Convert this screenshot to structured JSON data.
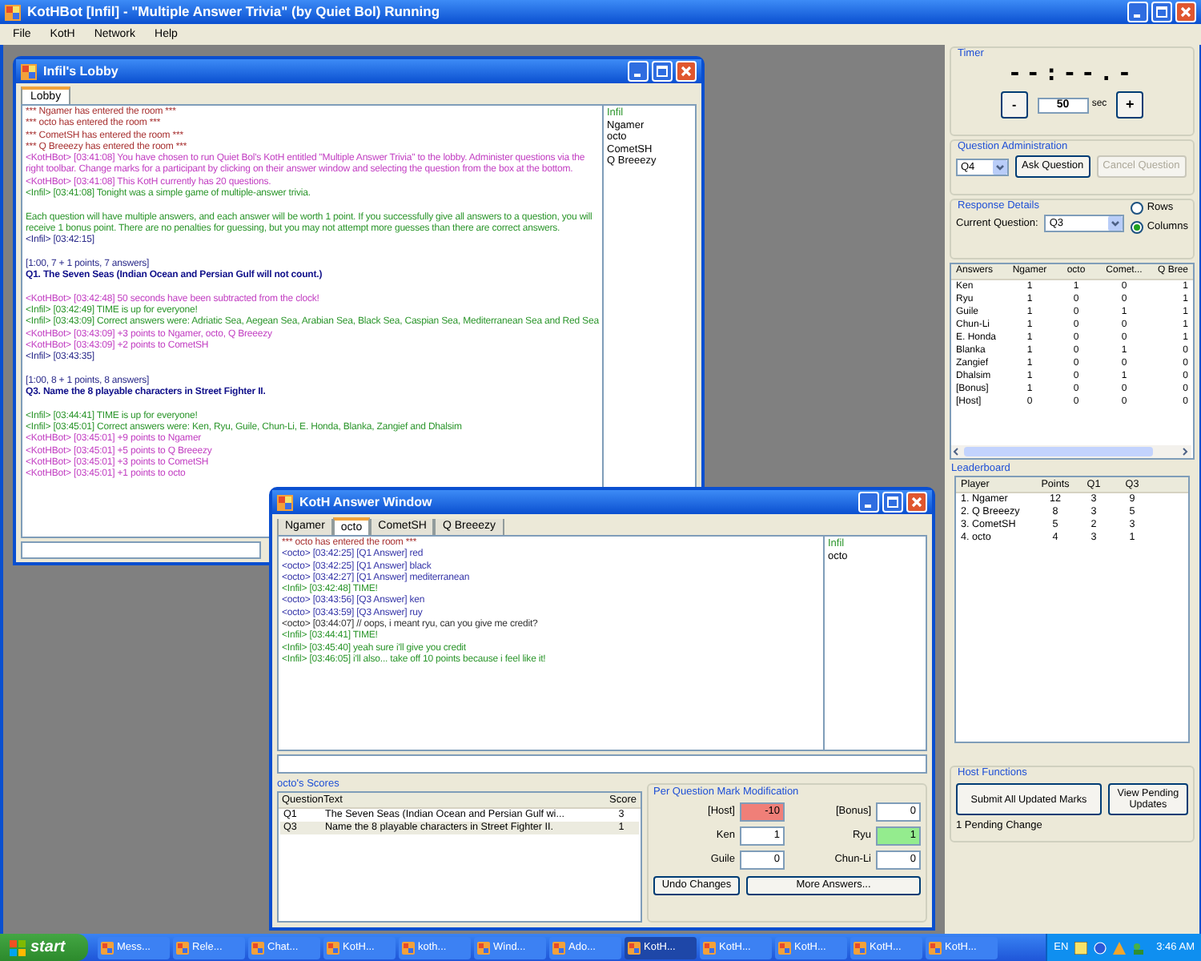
{
  "main_window": {
    "title": "KotHBot [Infil] - \"Multiple Answer Trivia\" (by Quiet Bol) Running",
    "menu": [
      "File",
      "KotH",
      "Network",
      "Help"
    ]
  },
  "lobby_window": {
    "title": "Infil's Lobby",
    "tabs": [
      {
        "label": "Lobby",
        "selected": true
      }
    ],
    "messages": [
      {
        "kind": "system",
        "text": "*** Ngamer has entered the room ***"
      },
      {
        "kind": "system",
        "text": "*** octo has entered the room ***"
      },
      {
        "kind": "system",
        "text": "*** CometSH has entered the room ***"
      },
      {
        "kind": "system",
        "text": "*** Q Breeezy has entered the room ***"
      },
      {
        "kind": "bot",
        "text": "<KotHBot> [03:41:08] You have chosen to run Quiet Bol's KotH entitled \"Multiple Answer Trivia\" to the lobby. Administer questions via the right toolbar. Change marks for a participant by clicking on their answer window and selecting the question from the box at the bottom."
      },
      {
        "kind": "bot",
        "text": "<KotHBot> [03:41:08] This KotH currently has 20 questions."
      },
      {
        "kind": "host",
        "text": "<Infil> [03:41:08] Tonight was a simple game of multiple-answer trivia."
      },
      {
        "kind": "blank"
      },
      {
        "kind": "host",
        "text": "Each question will have multiple answers, and each answer will be worth 1 point. If you successfully give all answers to a question, you will receive 1 bonus point. There are no penalties for guessing, but you may not attempt more guesses than there are correct answers."
      },
      {
        "kind": "note",
        "text": "<Infil> [03:42:15]"
      },
      {
        "kind": "blank"
      },
      {
        "kind": "note",
        "text": "[1:00, 7 + 1 points, 7 answers]"
      },
      {
        "kind": "question",
        "text": "Q1. The Seven Seas (Indian Ocean and Persian Gulf will not count.)"
      },
      {
        "kind": "blank"
      },
      {
        "kind": "bot",
        "text": "<KotHBot> [03:42:48] 50 seconds have been subtracted from the clock!"
      },
      {
        "kind": "host",
        "text": "<Infil> [03:42:49] TIME is up for everyone!"
      },
      {
        "kind": "host",
        "text": "<Infil> [03:43:09] Correct answers were: Adriatic Sea, Aegean Sea, Arabian Sea, Black Sea, Caspian Sea, Mediterranean Sea and Red Sea"
      },
      {
        "kind": "bot",
        "text": "<KotHBot> [03:43:09] +3 points to Ngamer, octo, Q Breeezy"
      },
      {
        "kind": "bot",
        "text": "<KotHBot> [03:43:09] +2 points to CometSH"
      },
      {
        "kind": "note",
        "text": "<Infil> [03:43:35]"
      },
      {
        "kind": "blank"
      },
      {
        "kind": "note",
        "text": "[1:00, 8 + 1 points, 8 answers]"
      },
      {
        "kind": "question",
        "text": "Q3. Name the 8 playable characters in Street Fighter II."
      },
      {
        "kind": "blank"
      },
      {
        "kind": "host",
        "text": "<Infil> [03:44:41] TIME is up for everyone!"
      },
      {
        "kind": "host",
        "text": "<Infil> [03:45:01] Correct answers were: Ken, Ryu, Guile, Chun-Li, E. Honda, Blanka, Zangief and Dhalsim"
      },
      {
        "kind": "bot",
        "text": "<KotHBot> [03:45:01] +9 points to Ngamer"
      },
      {
        "kind": "bot",
        "text": "<KotHBot> [03:45:01] +5 points to Q Breeezy"
      },
      {
        "kind": "bot",
        "text": "<KotHBot> [03:45:01] +3 points to CometSH"
      },
      {
        "kind": "bot",
        "text": "<KotHBot> [03:45:01] +1 points to octo"
      }
    ],
    "users": [
      {
        "name": "Infil",
        "kind": "host"
      },
      {
        "name": "Ngamer",
        "kind": "user"
      },
      {
        "name": "octo",
        "kind": "user"
      },
      {
        "name": "CometSH",
        "kind": "user"
      },
      {
        "name": "Q Breeezy",
        "kind": "user"
      }
    ]
  },
  "answer_window": {
    "title": "KotH Answer Window",
    "tabs": [
      {
        "label": "Ngamer",
        "selected": false
      },
      {
        "label": "octo",
        "selected": true
      },
      {
        "label": "CometSH",
        "selected": false
      },
      {
        "label": "Q Breeezy",
        "selected": false
      }
    ],
    "messages": [
      {
        "kind": "system",
        "text": "*** octo has entered the room ***"
      },
      {
        "kind": "answer",
        "text": "<octo> [03:42:25] [Q1 Answer] red"
      },
      {
        "kind": "answer",
        "text": "<octo> [03:42:25] [Q1 Answer] black"
      },
      {
        "kind": "answer",
        "text": "<octo> [03:42:27] [Q1 Answer] mediterranean"
      },
      {
        "kind": "host",
        "text": "<Infil> [03:42:48] TIME!"
      },
      {
        "kind": "answer",
        "text": "<octo> [03:43:56] [Q3 Answer] ken"
      },
      {
        "kind": "answer",
        "text": "<octo> [03:43:59] [Q3 Answer] ruy"
      },
      {
        "kind": "chat",
        "text": "<octo> [03:44:07] // oops, i meant ryu, can you give me credit?"
      },
      {
        "kind": "host",
        "text": "<Infil> [03:44:41] TIME!"
      },
      {
        "kind": "host",
        "text": "<Infil> [03:45:40] yeah sure i'll give you credit"
      },
      {
        "kind": "host",
        "text": "<Infil> [03:46:05] i'll also... take off 10 points because i feel like it!"
      }
    ],
    "users": [
      {
        "name": "Infil",
        "kind": "host"
      },
      {
        "name": "octo",
        "kind": "user"
      }
    ],
    "scores": {
      "title": "octo's Scores",
      "columns": [
        "Question",
        "Text",
        "Score"
      ],
      "rows": [
        {
          "cells": [
            "Q1",
            "The Seven Seas (Indian Ocean and Persian Gulf wi...",
            "3"
          ],
          "selected": false
        },
        {
          "cells": [
            "Q3",
            "Name the 8 playable characters in Street Fighter II.",
            "1"
          ],
          "selected": true
        }
      ]
    },
    "mark_modification": {
      "title": "Per Question Mark Modification",
      "fields": [
        {
          "label": "[Host]",
          "value": "-10",
          "color": "#f07f78"
        },
        {
          "label": "[Bonus]",
          "value": "0",
          "color": "#ffffff"
        },
        {
          "label": "Ken",
          "value": "1",
          "color": "#ffffff"
        },
        {
          "label": "Ryu",
          "value": "1",
          "color": "#94ec8e"
        },
        {
          "label": "Guile",
          "value": "0",
          "color": "#ffffff"
        },
        {
          "label": "Chun-Li",
          "value": "0",
          "color": "#ffffff"
        }
      ],
      "buttons": [
        "Undo Changes",
        "More Answers..."
      ]
    }
  },
  "side_panel": {
    "timer": {
      "title": "Timer",
      "display": "--:--.-",
      "decrement": "-",
      "seconds": "50",
      "unit": "sec",
      "increment": "+"
    },
    "question_admin": {
      "title": "Question Administration",
      "question": "Q4",
      "ask_button": {
        "label": "Ask Question",
        "disabled": false
      },
      "cancel_button": {
        "label": "Cancel Question",
        "disabled": true
      }
    },
    "response_details": {
      "title": "Response Details",
      "current_label": "Current Question:",
      "current_question": "Q3",
      "layout_options": [
        {
          "label": "Rows",
          "selected": false
        },
        {
          "label": "Columns",
          "selected": true
        }
      ],
      "table": {
        "columns": [
          "Answers",
          "Ngamer",
          "octo",
          "Comet...",
          "Q Bree"
        ],
        "rows": [
          [
            "Ken",
            "1",
            "1",
            "0",
            "1"
          ],
          [
            "Ryu",
            "1",
            "0",
            "0",
            "1"
          ],
          [
            "Guile",
            "1",
            "0",
            "1",
            "1"
          ],
          [
            "Chun-Li",
            "1",
            "0",
            "0",
            "1"
          ],
          [
            "E. Honda",
            "1",
            "0",
            "0",
            "1"
          ],
          [
            "Blanka",
            "1",
            "0",
            "1",
            "0"
          ],
          [
            "Zangief",
            "1",
            "0",
            "0",
            "0"
          ],
          [
            "Dhalsim",
            "1",
            "0",
            "1",
            "0"
          ],
          [
            "[Bonus]",
            "1",
            "0",
            "0",
            "0"
          ],
          [
            "[Host]",
            "0",
            "0",
            "0",
            "0"
          ]
        ]
      }
    },
    "leaderboard": {
      "title": "Leaderboard",
      "columns": [
        "Player",
        "Points",
        "Q1",
        "Q3"
      ],
      "rows": [
        [
          "1. Ngamer",
          "12",
          "3",
          "9"
        ],
        [
          "2. Q Breeezy",
          "8",
          "3",
          "5"
        ],
        [
          "3. CometSH",
          "5",
          "2",
          "3"
        ],
        [
          "4. octo",
          "4",
          "3",
          "1"
        ]
      ]
    },
    "host_functions": {
      "title": "Host Functions",
      "buttons": [
        "Submit All Updated Marks",
        "View Pending Updates"
      ],
      "status": "1 Pending Change"
    }
  },
  "taskbar": {
    "start": "start",
    "items": [
      {
        "label": "Mess...",
        "selected": false
      },
      {
        "label": "Rele...",
        "selected": false
      },
      {
        "label": "Chat...",
        "selected": false
      },
      {
        "label": "KotH...",
        "selected": false
      },
      {
        "label": "koth...",
        "selected": false
      },
      {
        "label": "Wind...",
        "selected": false
      },
      {
        "label": "Ado...",
        "selected": false
      },
      {
        "label": "KotH...",
        "selected": true
      },
      {
        "label": "KotH...",
        "selected": false
      },
      {
        "label": "KotH...",
        "selected": false
      },
      {
        "label": "KotH...",
        "selected": false
      },
      {
        "label": "KotH...",
        "selected": false
      }
    ],
    "language": "EN",
    "clock": "3:46 AM"
  }
}
